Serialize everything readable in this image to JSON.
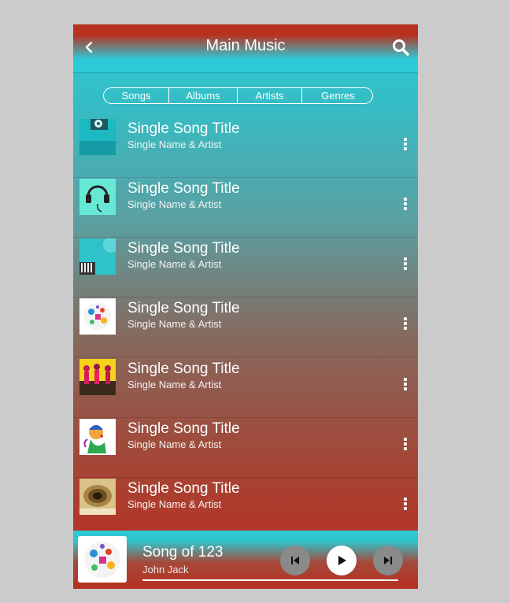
{
  "header": {
    "title": "Main Music",
    "back_icon": "chevron-left-icon",
    "search_icon": "search-icon"
  },
  "tabs": [
    "Songs",
    "Albums",
    "Artists",
    "Genres"
  ],
  "songs": [
    {
      "title": "Single Song Title",
      "artist": "Single Name & Artist",
      "art": "teal-player-art"
    },
    {
      "title": "Single Song Title",
      "artist": "Single Name & Artist",
      "art": "headphones-art"
    },
    {
      "title": "Single Song Title",
      "artist": "Single Name & Artist",
      "art": "keyboard-art"
    },
    {
      "title": "Single Song Title",
      "artist": "Single Name & Artist",
      "art": "instruments-circle-art"
    },
    {
      "title": "Single Song Title",
      "artist": "Single Name & Artist",
      "art": "dancers-art"
    },
    {
      "title": "Single Song Title",
      "artist": "Single Name & Artist",
      "art": "singer-art"
    },
    {
      "title": "Single Song Title",
      "artist": "Single Name & Artist",
      "art": "book-swirl-art"
    }
  ],
  "now_playing": {
    "title": "Song of 123",
    "artist": "John Jack",
    "progress": 0.94,
    "controls": {
      "previous": "skip-previous-icon",
      "play": "play-icon",
      "next": "skip-next-icon"
    }
  },
  "colors": {
    "header_red": "#b8311f",
    "teal": "#2dcad6",
    "bottom_red": "#b52f20"
  }
}
